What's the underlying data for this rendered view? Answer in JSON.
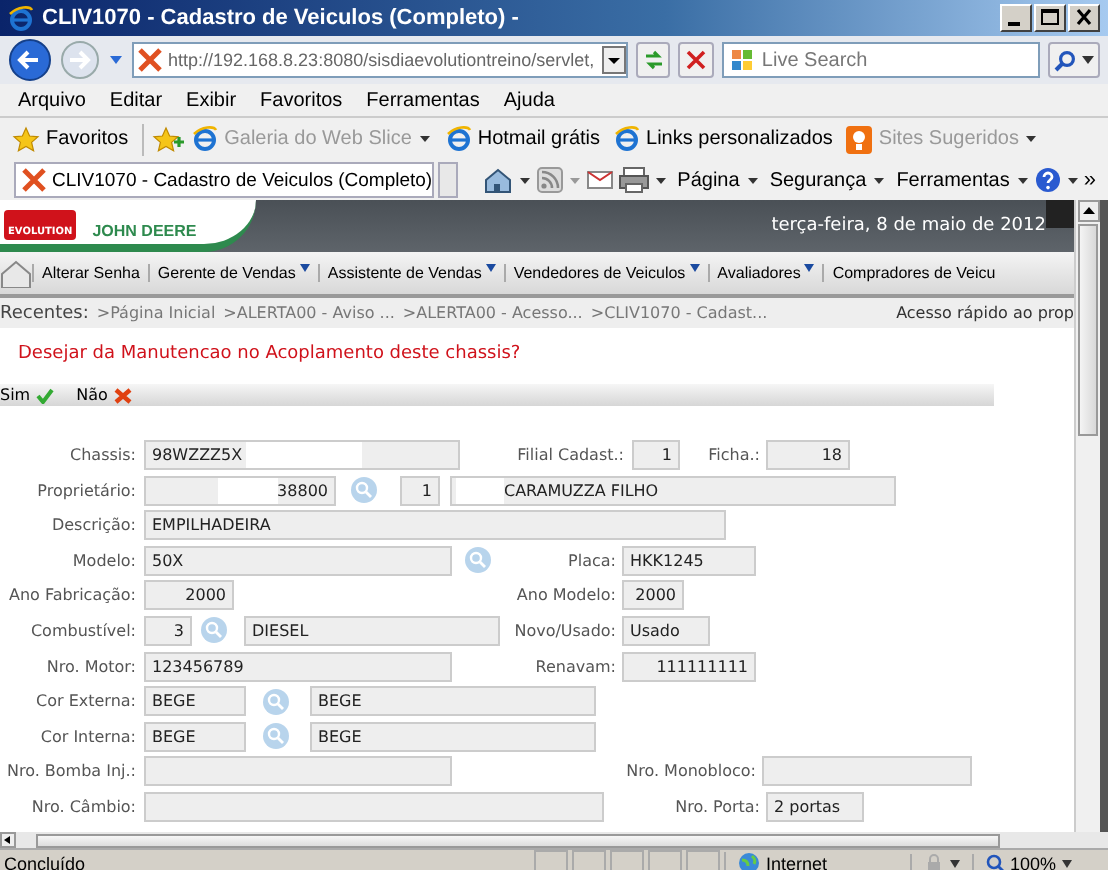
{
  "window": {
    "title": "CLIV1070 - Cadastro de Veiculos (Completo) -"
  },
  "address_bar": {
    "url": "http://192.168.8.23:8080/sisdiaevolutiontreino/servlet,",
    "search": {
      "placeholder": "Live Search"
    }
  },
  "menu_bar": [
    "Arquivo",
    "Editar",
    "Exibir",
    "Favoritos",
    "Ferramentas",
    "Ajuda"
  ],
  "favorites_bar": {
    "label": "Favoritos",
    "links": [
      {
        "text": "Galeria do Web Slice",
        "disabled": true,
        "dropdown": true
      },
      {
        "text": "Hotmail grátis",
        "disabled": false,
        "dropdown": false
      },
      {
        "text": "Links personalizados",
        "disabled": false,
        "dropdown": false
      },
      {
        "text": "Sites Sugeridos",
        "disabled": true,
        "dropdown": true
      }
    ]
  },
  "tab": {
    "title": "CLIV1070 - Cadastro de Veiculos (Completo)"
  },
  "command_bar": [
    "Página",
    "Segurança",
    "Ferramentas"
  ],
  "command_overflow": "»",
  "header": {
    "logo_text": "EVOLUTION",
    "brand": "JOHN DEERE",
    "date": "terça-feira, 8 de maio de 2012"
  },
  "nav_menu": [
    {
      "label": "Alterar Senha",
      "dropdown": false
    },
    {
      "label": "Gerente de Vendas",
      "dropdown": true
    },
    {
      "label": "Assistente de Vendas",
      "dropdown": true
    },
    {
      "label": "Vendedores de Veiculos",
      "dropdown": true
    },
    {
      "label": "Avaliadores",
      "dropdown": true
    },
    {
      "label": "Compradores de Veicu",
      "dropdown": false
    }
  ],
  "recent": {
    "label": "Recentes:",
    "items": [
      ">Página Inicial",
      ">ALERTA00 - Aviso  ...",
      ">ALERTA00 - Acesso...",
      ">CLIV1070 - Cadast..."
    ],
    "quick_access": "Acesso rápido ao prop"
  },
  "question": "Desejar da Manutencao no Acoplamento deste chassis?",
  "actions": [
    {
      "label": "Sim",
      "kind": "yes"
    },
    {
      "label": "Não",
      "kind": "no"
    }
  ],
  "form": {
    "rows": [
      {
        "items": [
          {
            "kind": "label",
            "text": "Chassis:"
          },
          {
            "kind": "field",
            "value": "98WZZZ5X",
            "masked_after": true
          },
          {
            "kind": "label",
            "text": "Filial Cadast.:"
          },
          {
            "kind": "field",
            "value": "1"
          },
          {
            "kind": "label",
            "text": "Ficha.:"
          },
          {
            "kind": "field",
            "value": "18"
          }
        ]
      },
      {
        "items": [
          {
            "kind": "label",
            "text": "Proprietário:"
          },
          {
            "kind": "field",
            "value": "38800",
            "masked_before": true
          },
          {
            "kind": "lookup"
          },
          {
            "kind": "field",
            "value": "1"
          },
          {
            "kind": "field",
            "value": "CARAMUZZA FILHO",
            "masked_before": true
          }
        ]
      },
      {
        "items": [
          {
            "kind": "label",
            "text": "Descrição:"
          },
          {
            "kind": "field",
            "value": "EMPILHADEIRA"
          }
        ]
      },
      {
        "items": [
          {
            "kind": "label",
            "text": "Modelo:"
          },
          {
            "kind": "field",
            "value": "50X"
          },
          {
            "kind": "lookup"
          },
          {
            "kind": "label",
            "text": "Placa:"
          },
          {
            "kind": "field",
            "value": "HKK1245"
          }
        ]
      },
      {
        "items": [
          {
            "kind": "label",
            "text": "Ano Fabricação:"
          },
          {
            "kind": "field",
            "value": "2000"
          },
          {
            "kind": "label",
            "text": "Ano Modelo:"
          },
          {
            "kind": "field",
            "value": "2000"
          }
        ]
      },
      {
        "items": [
          {
            "kind": "label",
            "text": "Combustível:"
          },
          {
            "kind": "field",
            "value": "3"
          },
          {
            "kind": "lookup"
          },
          {
            "kind": "field",
            "value": "DIESEL"
          },
          {
            "kind": "label",
            "text": "Novo/Usado:"
          },
          {
            "kind": "field",
            "value": "Usado"
          }
        ]
      },
      {
        "items": [
          {
            "kind": "label",
            "text": "Nro. Motor:"
          },
          {
            "kind": "field",
            "value": "123456789"
          },
          {
            "kind": "label",
            "text": "Renavam:"
          },
          {
            "kind": "field",
            "value": "111111111"
          }
        ]
      },
      {
        "items": [
          {
            "kind": "label",
            "text": "Cor Externa:"
          },
          {
            "kind": "field",
            "value": "BEGE"
          },
          {
            "kind": "lookup"
          },
          {
            "kind": "field",
            "value": "BEGE"
          }
        ]
      },
      {
        "items": [
          {
            "kind": "label",
            "text": "Cor Interna:"
          },
          {
            "kind": "field",
            "value": "BEGE"
          },
          {
            "kind": "lookup"
          },
          {
            "kind": "field",
            "value": "BEGE"
          }
        ]
      },
      {
        "items": [
          {
            "kind": "label",
            "text": "Nro. Bomba Inj.:"
          },
          {
            "kind": "field"
          },
          {
            "kind": "label",
            "text": "Nro. Monobloco:"
          },
          {
            "kind": "field"
          }
        ]
      },
      {
        "items": [
          {
            "kind": "label",
            "text": "Nro. Câmbio:"
          },
          {
            "kind": "field"
          },
          {
            "kind": "label",
            "text": "Nro. Porta:"
          },
          {
            "kind": "field",
            "value": "2 portas"
          }
        ]
      }
    ]
  },
  "status_bar": {
    "text": "Concluído",
    "zone": "Internet",
    "zoom": "100%"
  }
}
